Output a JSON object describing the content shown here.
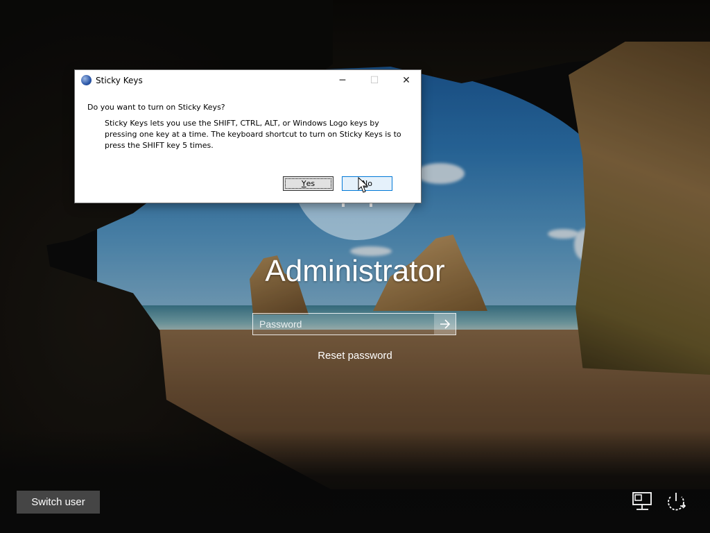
{
  "login": {
    "username": "Administrator",
    "password_placeholder": "Password",
    "submit_icon": "arrow-right-icon",
    "reset_password": "Reset password",
    "switch_user": "Switch user",
    "bottom_icons": [
      "network-icon",
      "power-icon"
    ]
  },
  "dialog": {
    "title": "Sticky Keys",
    "question": "Do you want to turn on Sticky Keys?",
    "description": "Sticky Keys lets you use the SHIFT, CTRL, ALT, or Windows Logo keys by pressing one key at a time. The keyboard shortcut to turn on Sticky Keys is to press the SHIFT key 5 times.",
    "yes_mnemonic": "Y",
    "yes_rest": "es",
    "no_mnemonic": "N",
    "no_rest": "o",
    "controls": {
      "minimize": "─",
      "maximize": "☐",
      "close": "✕"
    }
  }
}
